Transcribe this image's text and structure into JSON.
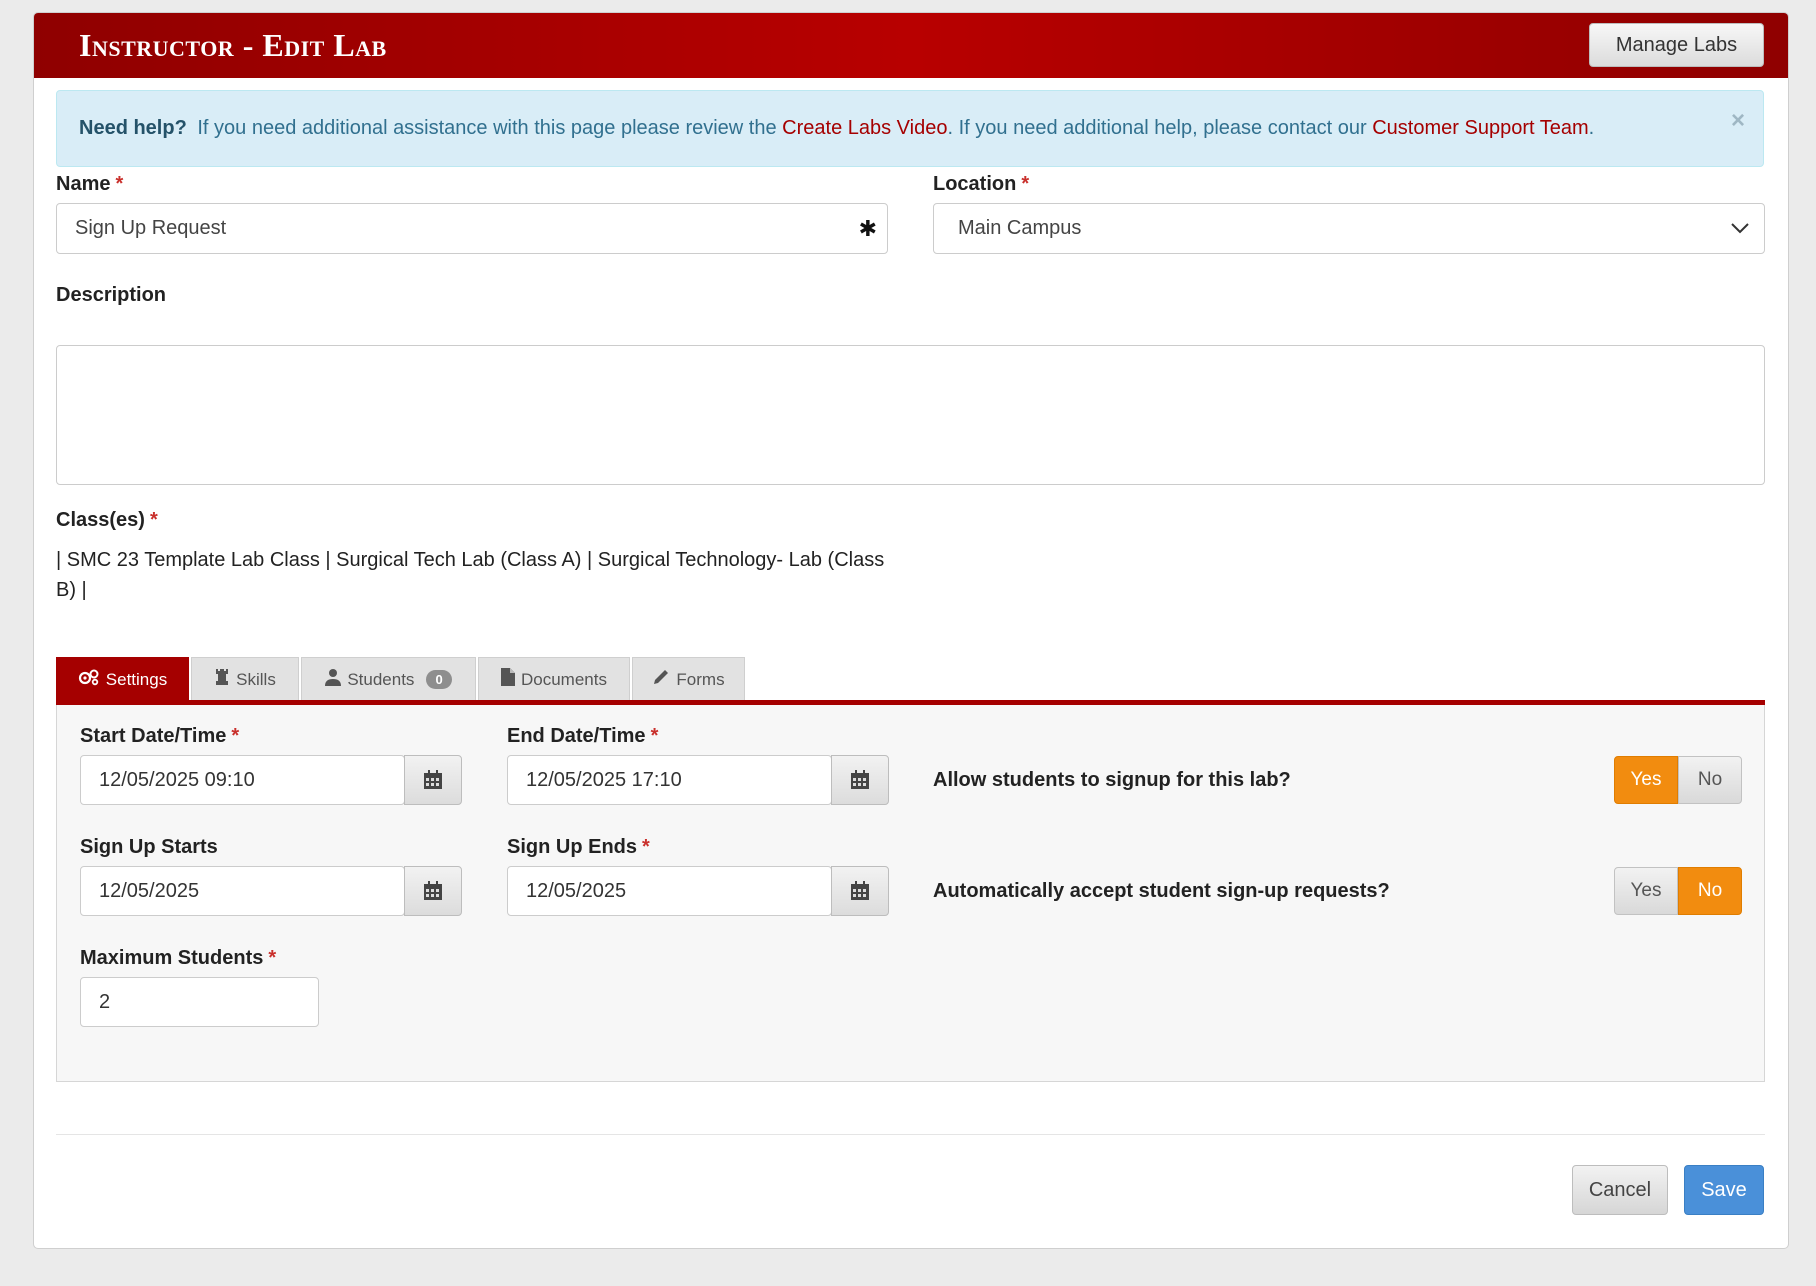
{
  "header": {
    "title": "Instructor - Edit Lab",
    "manage_labs_label": "Manage Labs"
  },
  "alert": {
    "lead": "Need help?",
    "text1": "If you need additional assistance with this page please review the",
    "link1": "Create Labs Video",
    "text2": ". If you need additional help, please contact our",
    "link2": "Customer Support Team",
    "text3": ".",
    "close": "×"
  },
  "form": {
    "required_mark": "*",
    "name_label": "Name",
    "name_value": "Sign Up Request",
    "location_label": "Location",
    "location_value": "Main Campus",
    "description_label": "Description",
    "description_value": "",
    "classes_label": "Class(es)",
    "classes_value": " |  SMC 23 Template Lab Class |  Surgical Tech Lab (Class A) |  Surgical Technology- Lab (Class B) |"
  },
  "tabs": [
    {
      "label": "Settings",
      "icon": "gears-icon",
      "active": true
    },
    {
      "label": "Skills",
      "icon": "chess-rook-icon",
      "active": false
    },
    {
      "label": "Students",
      "icon": "user-icon",
      "badge": "0",
      "active": false
    },
    {
      "label": "Documents",
      "icon": "file-icon",
      "active": false
    },
    {
      "label": "Forms",
      "icon": "pencil-icon",
      "active": false
    }
  ],
  "settings": {
    "start_label": "Start Date/Time",
    "start_value": "12/05/2025 09:10",
    "end_label": "End Date/Time",
    "end_value": "12/05/2025 17:10",
    "signup_starts_label": "Sign Up Starts",
    "signup_starts_value": "12/05/2025",
    "signup_ends_label": "Sign Up Ends",
    "signup_ends_value": "12/05/2025",
    "max_students_label": "Maximum Students",
    "max_students_value": "2",
    "allow_signup_question": "Allow students to signup for this lab?",
    "allow_signup_selected": "Yes",
    "auto_accept_question": "Automatically accept student sign-up requests?",
    "auto_accept_selected": "No",
    "yes_label": "Yes",
    "no_label": "No"
  },
  "footer": {
    "cancel_label": "Cancel",
    "save_label": "Save"
  },
  "colors": {
    "brand": "#a50000",
    "toggle_active": "#f28c0f",
    "save_button": "#4a90d9",
    "alert_bg": "#d9edf7"
  }
}
